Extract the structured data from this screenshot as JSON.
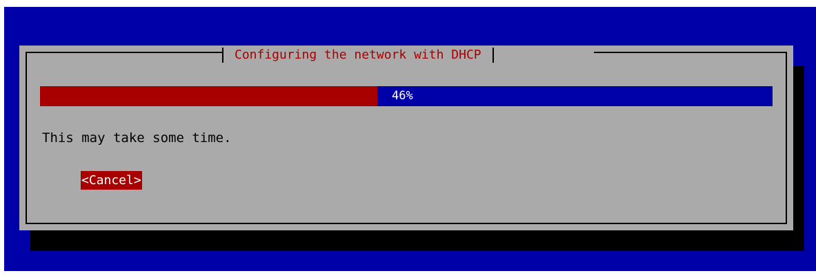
{
  "dialog": {
    "title": "Configuring the network with DHCP",
    "progress": {
      "percent": 46,
      "label": "46%"
    },
    "message": "This may take some time.",
    "cancel_label": "<Cancel>"
  },
  "colors": {
    "screen_background": "#0000a8",
    "dialog_background": "#aaaaaa",
    "shadow": "#000000",
    "title_text": "#a80000",
    "progress_filled": "#a80000",
    "progress_empty": "#0000a8",
    "button_background": "#a80000",
    "button_text": "#ffffff"
  }
}
